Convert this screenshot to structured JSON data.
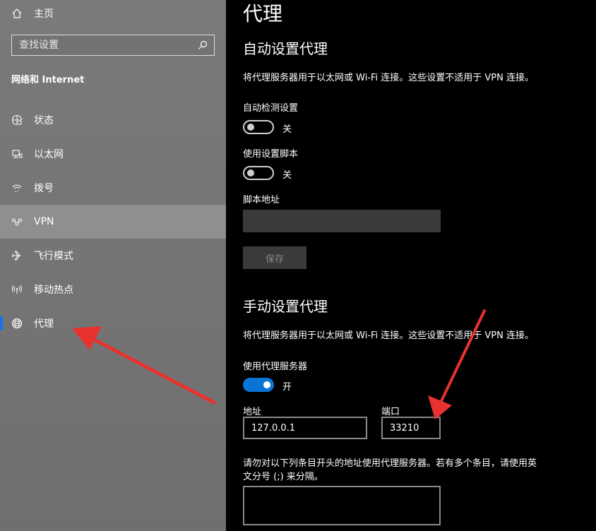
{
  "sidebar": {
    "home_label": "主页",
    "search_placeholder": "查找设置",
    "section_title": "网络和 Internet",
    "items": [
      {
        "label": "状态",
        "icon": "status-icon"
      },
      {
        "label": "以太网",
        "icon": "ethernet-icon"
      },
      {
        "label": "拨号",
        "icon": "dialup-icon"
      },
      {
        "label": "VPN",
        "icon": "vpn-icon"
      },
      {
        "label": "飞行模式",
        "icon": "airplane-icon"
      },
      {
        "label": "移动热点",
        "icon": "hotspot-icon"
      },
      {
        "label": "代理",
        "icon": "globe-icon",
        "selected": true
      }
    ]
  },
  "main": {
    "title": "代理",
    "auto": {
      "heading": "自动设置代理",
      "description": "将代理服务器用于以太网或 Wi-Fi 连接。这些设置不适用于 VPN 连接。",
      "auto_detect_label": "自动检测设置",
      "auto_detect_state": "关",
      "use_script_label": "使用设置脚本",
      "use_script_state": "关",
      "script_address_label": "脚本地址",
      "script_address_value": "",
      "save_label": "保存"
    },
    "manual": {
      "heading": "手动设置代理",
      "description": "将代理服务器用于以太网或 Wi-Fi 连接。这些设置不适用于 VPN 连接。",
      "use_proxy_label": "使用代理服务器",
      "use_proxy_state": "开",
      "address_label": "地址",
      "address_value": "127.0.0.1",
      "port_label": "端口",
      "port_value": "33210",
      "exceptions_note_line1": "请勿对以下列条目开头的地址使用代理服务器。若有多个条目，请使用英",
      "exceptions_note_line2": "文分号 (;) 来分隔。",
      "exceptions_value": ""
    }
  },
  "colors": {
    "sidebar_bg": "#757575",
    "main_bg": "#000000",
    "accent": "#0a74d6",
    "annotation_arrow": "#e8322f"
  }
}
